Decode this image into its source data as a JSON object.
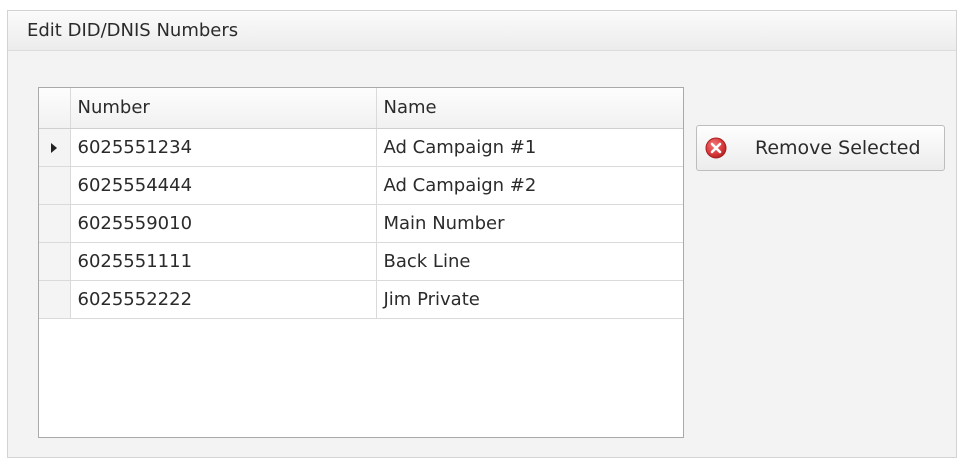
{
  "panel": {
    "title": "Edit DID/DNIS Numbers"
  },
  "grid": {
    "columns": [
      "Number",
      "Name"
    ],
    "rows": [
      {
        "number": "6025551234",
        "name": "Ad Campaign #1",
        "focused": true
      },
      {
        "number": "6025554444",
        "name": "Ad Campaign #2",
        "focused": false
      },
      {
        "number": "6025559010",
        "name": "Main Number",
        "focused": false
      },
      {
        "number": "6025551111",
        "name": "Back Line",
        "focused": false
      },
      {
        "number": "6025552222",
        "name": "Jim Private",
        "focused": false
      }
    ],
    "focused_row_indicator_icon": "row-indicator-arrow-icon"
  },
  "actions": {
    "remove_selected_label": "Remove Selected",
    "remove_icon": "delete-x-icon",
    "remove_icon_color": "#d9383a"
  }
}
